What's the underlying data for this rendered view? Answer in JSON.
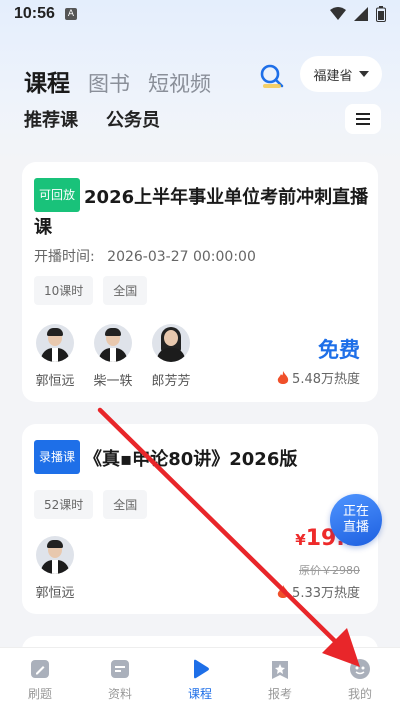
{
  "status_bar": {
    "time": "10:56",
    "sim_label": "A"
  },
  "header": {
    "tabs": [
      {
        "label": "课程",
        "active": true
      },
      {
        "label": "图书",
        "active": false
      },
      {
        "label": "短视频",
        "active": false
      }
    ],
    "region": "福建省",
    "subtabs": [
      "推荐课",
      "公务员"
    ]
  },
  "courses": [
    {
      "tag": "可回放",
      "tag_color": "#19c27a",
      "title": "2026上半年事业单位考前冲刺直播课",
      "start_label": "开播时间:",
      "start_time": "2026-03-27 00:00:00",
      "pills": [
        "10课时",
        "全国"
      ],
      "teachers": [
        "郭恒远",
        "柴一轶",
        "郎芳芳"
      ],
      "price": "免费",
      "heat": "5.48万热度"
    },
    {
      "tag": "录播课",
      "tag_color": "#1e6fe8",
      "title": "《真▪申论80讲》2026版",
      "pills": [
        "52课时",
        "全国"
      ],
      "teachers": [
        "郭恒远"
      ],
      "price_currency": "¥",
      "price": "19.9",
      "original_price": "原价￥2980",
      "heat": "5.33万热度"
    }
  ],
  "live_bubble": {
    "line1": "正在",
    "line2": "直播"
  },
  "bottom_nav": [
    {
      "label": "刷题",
      "icon": "pencil-icon",
      "active": false
    },
    {
      "label": "资料",
      "icon": "document-icon",
      "active": false
    },
    {
      "label": "课程",
      "icon": "play-icon",
      "active": true
    },
    {
      "label": "报考",
      "icon": "star-badge-icon",
      "active": false
    },
    {
      "label": "我的",
      "icon": "profile-icon",
      "active": false
    }
  ],
  "colors": {
    "accent": "#1e6fe8",
    "price_red": "#ee2a2a",
    "annotation_arrow": "#e8262a"
  }
}
